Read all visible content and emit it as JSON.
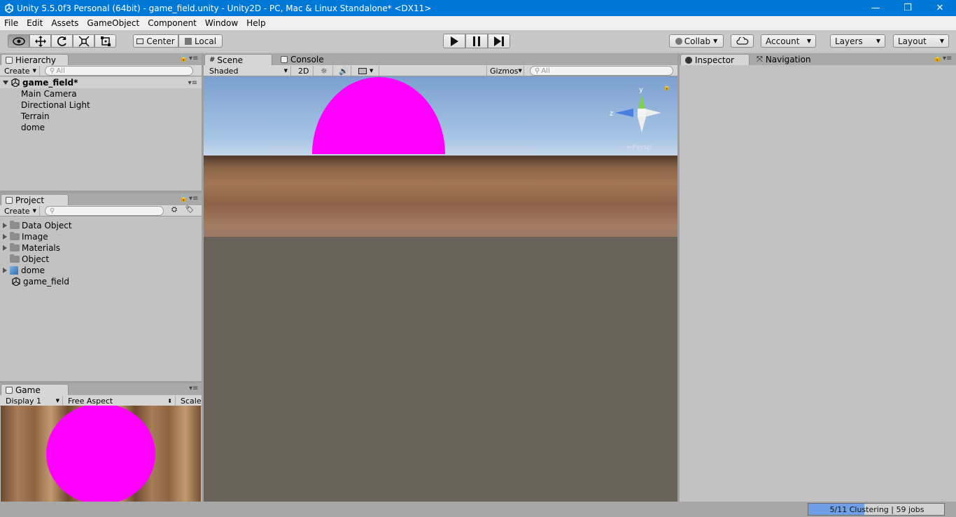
{
  "window": {
    "title": "Unity 5.5.0f3 Personal (64bit) - game_field.unity - Unity2D - PC, Mac & Linux Standalone* <DX11>",
    "minimize_glyph": "—",
    "restore_glyph": "❐",
    "close_glyph": "✕"
  },
  "menu": [
    "File",
    "Edit",
    "Assets",
    "GameObject",
    "Component",
    "Window",
    "Help"
  ],
  "toolbar": {
    "pivot_label": "Center",
    "space_label": "Local",
    "collab_label": "Collab",
    "account_label": "Account",
    "layers_label": "Layers",
    "layout_label": "Layout",
    "tools": [
      "eye-icon",
      "move-icon",
      "rotate-icon",
      "scale-icon",
      "rect-icon"
    ],
    "play_icons": [
      "play-icon",
      "pause-icon",
      "step-icon"
    ]
  },
  "hierarchy": {
    "tab": "Hierarchy",
    "create_label": "Create",
    "search_placeholder": "All",
    "scene_name": "game_field*",
    "items": [
      "Main Camera",
      "Directional Light",
      "Terrain",
      "dome"
    ]
  },
  "project": {
    "tab": "Project",
    "create_label": "Create",
    "items": [
      {
        "label": "Data Object",
        "kind": "folder",
        "expandable": true
      },
      {
        "label": "Image",
        "kind": "folder",
        "expandable": true
      },
      {
        "label": "Materials",
        "kind": "folder",
        "expandable": true
      },
      {
        "label": "Object",
        "kind": "folder",
        "expandable": false
      },
      {
        "label": "dome",
        "kind": "prefab",
        "expandable": true
      },
      {
        "label": "game_field",
        "kind": "scene",
        "expandable": false
      }
    ]
  },
  "scene": {
    "tab_scene": "Scene",
    "tab_console": "Console",
    "shading": "Shaded",
    "mode_2d": "2D",
    "gizmos_label": "Gizmos",
    "search_placeholder": "All",
    "axis_y": "y",
    "axis_z": "z",
    "persp_label": "Persp",
    "dome_color": "#ff00ff"
  },
  "game": {
    "tab": "Game",
    "display": "Display 1",
    "aspect": "Free Aspect",
    "scale_label": "Scale"
  },
  "inspector": {
    "tab_inspector": "Inspector",
    "tab_navigation": "Navigation"
  },
  "status": {
    "progress_text": "5/11 Clustering | 59 jobs",
    "progress_fraction": 0.41,
    "accent": "#6f9fe6"
  }
}
